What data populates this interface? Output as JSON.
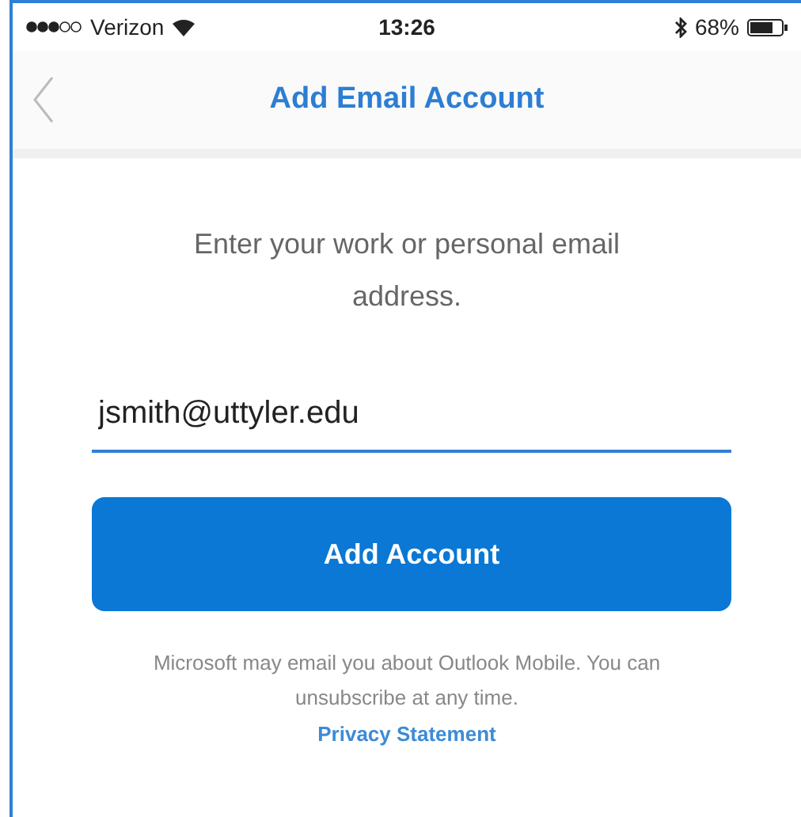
{
  "status_bar": {
    "carrier": "Verizon",
    "time": "13:26",
    "battery": "68%"
  },
  "nav_bar": {
    "title": "Add Email Account"
  },
  "prompt": "Enter your work or personal email address.",
  "email_field": {
    "value": "jsmith@uttyler.edu",
    "focused": true
  },
  "button": "Add Account",
  "disclaimer": "Microsoft may email you about Outlook Mobile. You can unsubscribe at any time.",
  "privacy_link": "Privacy Statement"
}
